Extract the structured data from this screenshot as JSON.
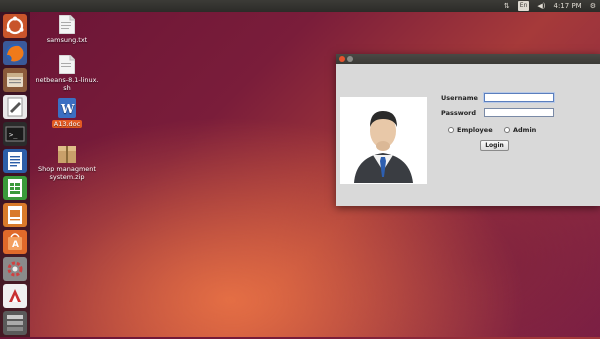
{
  "topbar": {
    "keyboard_indicator": "En",
    "time": "4:17 PM"
  },
  "launcher": {
    "items": [
      {
        "name": "ubuntu-dash-icon"
      },
      {
        "name": "firefox-icon"
      },
      {
        "name": "files-icon"
      },
      {
        "name": "text-editor-icon"
      },
      {
        "name": "terminal-icon"
      },
      {
        "name": "writer-icon"
      },
      {
        "name": "calc-icon"
      },
      {
        "name": "impress-icon"
      },
      {
        "name": "software-center-icon"
      },
      {
        "name": "system-settings-icon"
      },
      {
        "name": "java-app-icon"
      },
      {
        "name": "workspace-icon"
      }
    ]
  },
  "desktop": {
    "icons": [
      {
        "label": "samsung.txt"
      },
      {
        "label": "netbeans-8.1-linux.\nsh"
      },
      {
        "label": "A13.doc"
      },
      {
        "label": "Shop managment\nsystem.zip"
      }
    ]
  },
  "login_window": {
    "username_label": "Username",
    "password_label": "Password",
    "username_value": "",
    "password_value": "",
    "role_options": [
      "Employee",
      "Admin"
    ],
    "login_button": "Login"
  }
}
